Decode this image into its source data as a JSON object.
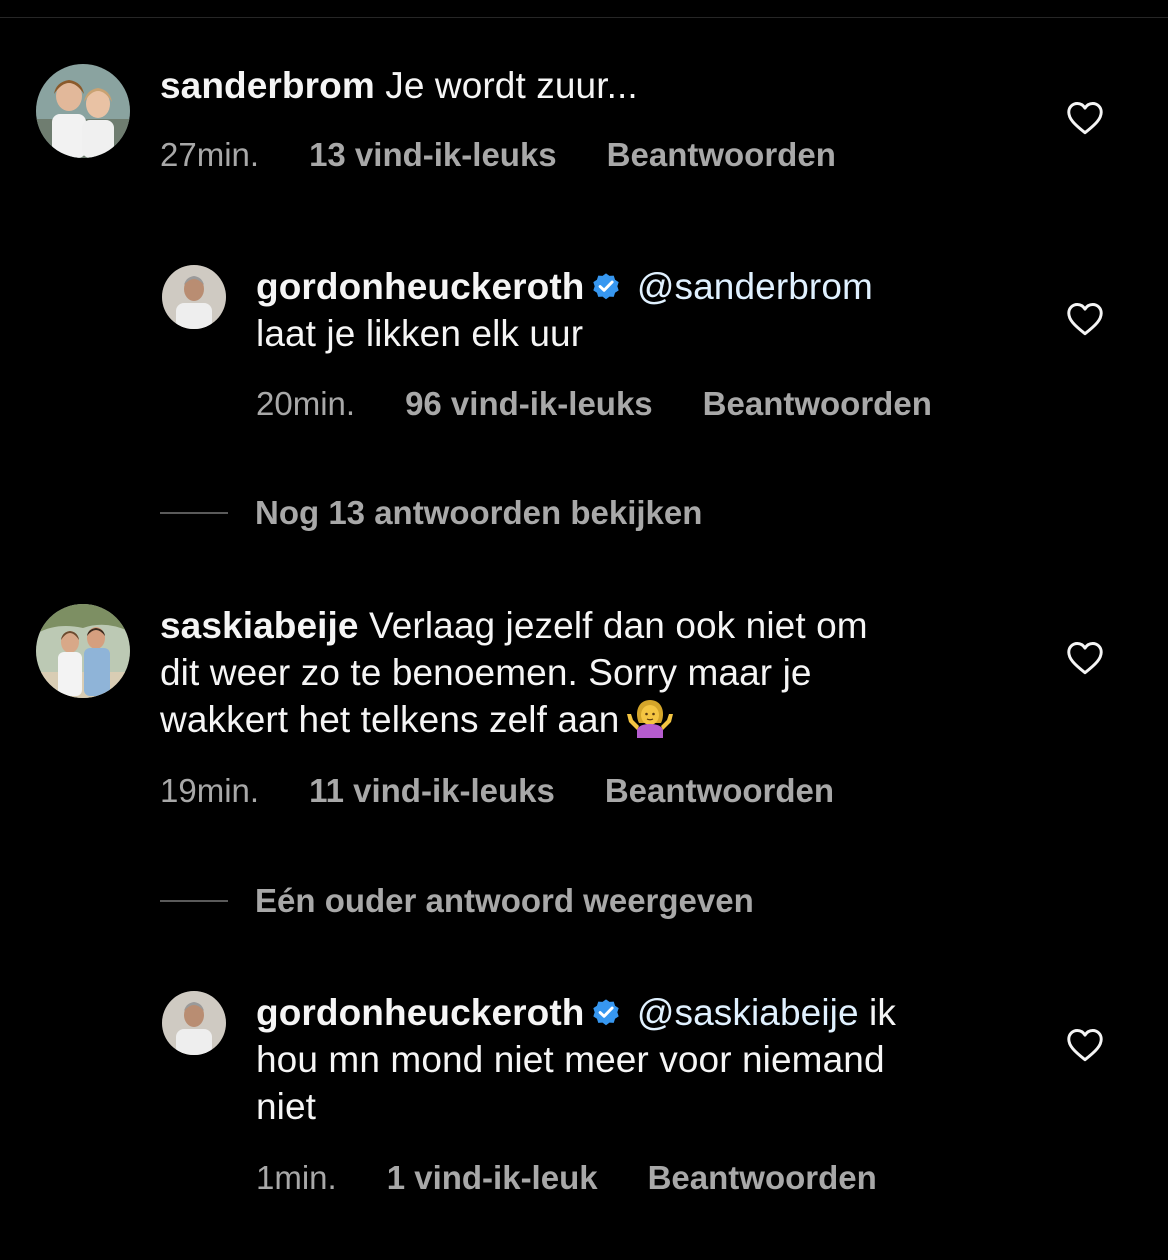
{
  "comments": [
    {
      "username": "sanderbrom",
      "verified": false,
      "text": "Je wordt zuur...",
      "time": "27min.",
      "likes": "13 vind-ik-leuks",
      "reply_label": "Beantwoorden"
    },
    {
      "username": "gordonheuckeroth",
      "verified": true,
      "mention": "@sanderbrom",
      "text": "laat je likken elk uur",
      "time": "20min.",
      "likes": "96 vind-ik-leuks",
      "reply_label": "Beantwoorden"
    },
    {
      "username": "saskiabeije",
      "verified": false,
      "text_lines": [
        "Verlaag jezelf dan ook niet om",
        "dit weer zo te benoemen. Sorry maar je",
        "wakkert het telkens zelf aan"
      ],
      "emoji": "person-shrugging-emoji",
      "time": "19min.",
      "likes": "11 vind-ik-leuks",
      "reply_label": "Beantwoorden"
    },
    {
      "username": "gordonheuckeroth",
      "verified": true,
      "mention": "@saskiabeije",
      "text_lines": [
        "ik",
        "hou mn mond niet meer voor niemand",
        "niet"
      ],
      "time": "1min.",
      "likes": "1 vind-ik-leuk",
      "reply_label": "Beantwoorden"
    }
  ],
  "threads": {
    "view_more": "Nog 13 antwoorden bekijken",
    "show_older": "Eén ouder antwoord weergeven"
  },
  "icons": {
    "like": "heart-outline-icon",
    "verified": "verified-badge-icon"
  },
  "colors": {
    "background": "#000000",
    "text": "#f5f5f5",
    "secondary": "#a8a8a8",
    "verified_blue": "#3797f0",
    "mention": "#e0f1ff"
  }
}
